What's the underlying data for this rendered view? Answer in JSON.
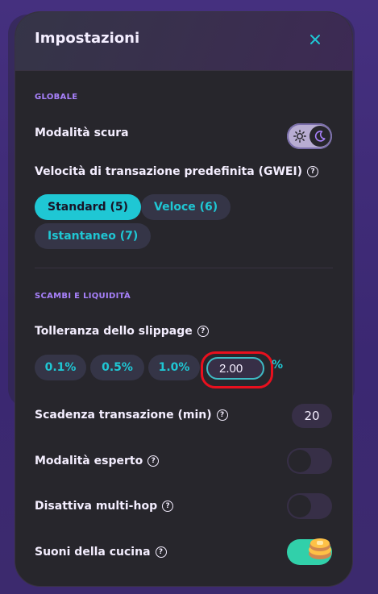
{
  "modal": {
    "title": "Impostazioni",
    "close_icon": "close-icon"
  },
  "global": {
    "section_title": "GLOBALE",
    "dark_mode_label": "Modalità scura",
    "dark_mode_on": true,
    "gas_label": "Velocità di transazione predefinita (GWEI)",
    "gas_options": [
      {
        "label": "Standard (5)",
        "active": true
      },
      {
        "label": "Veloce (6)",
        "active": false
      },
      {
        "label": "Istantaneo (7)",
        "active": false
      }
    ]
  },
  "swaps": {
    "section_title": "SCAMBI E LIQUIDITÀ",
    "slippage_label": "Tolleranza dello slippage",
    "slippage_options": [
      "0.1%",
      "0.5%",
      "1.0%"
    ],
    "slippage_custom_value": "2.00",
    "slippage_unit": "%",
    "deadline_label": "Scadenza transazione (min)",
    "deadline_value": "20",
    "expert_label": "Modalità esperto",
    "expert_on": false,
    "multihop_label": "Disattiva multi-hop",
    "multihop_on": false,
    "sounds_label": "Suoni della cucina",
    "sounds_on": true
  },
  "colors": {
    "accent": "#1fc7d4",
    "section": "#a881fc",
    "highlight": "#e8101e",
    "toggle_on": "#31d0aa"
  }
}
